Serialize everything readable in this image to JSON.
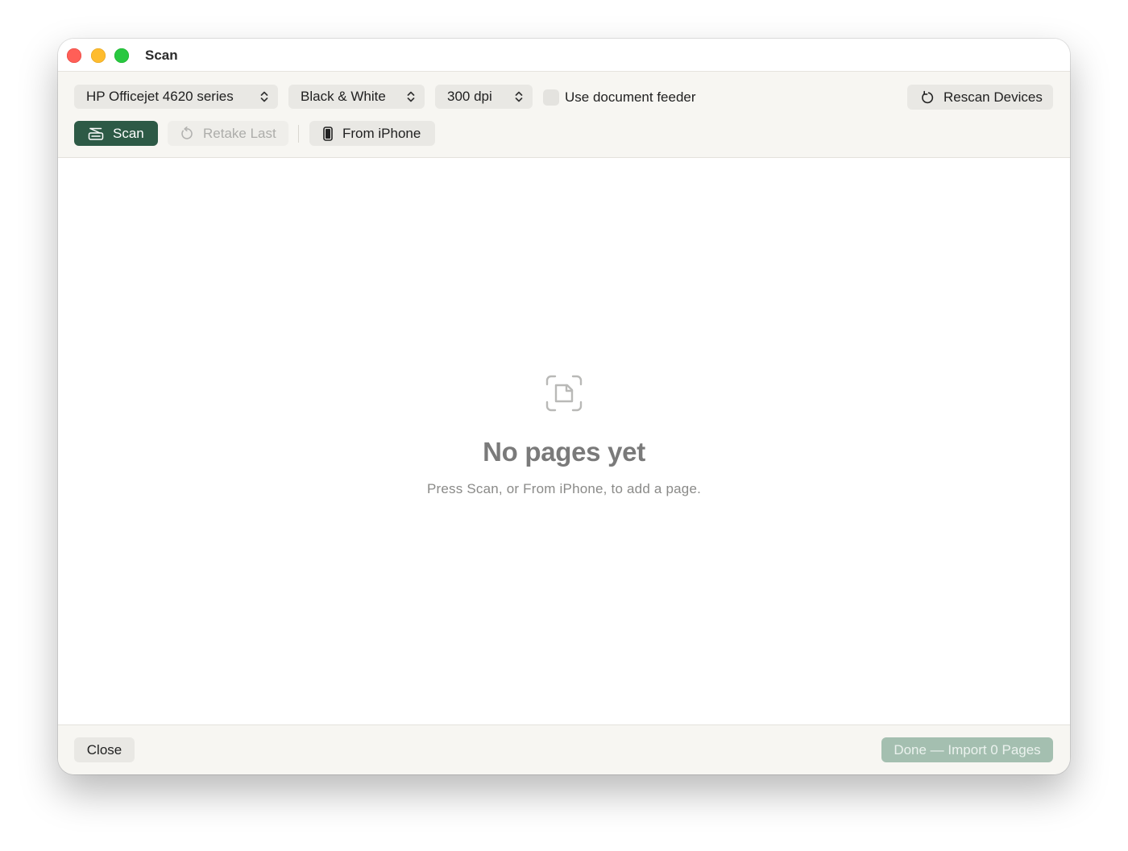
{
  "window": {
    "title": "Scan"
  },
  "toolbar": {
    "scanner_select": {
      "selected": "HP Officejet 4620 series"
    },
    "mode_select": {
      "selected": "Black & White"
    },
    "resolution_select": {
      "selected": "300 dpi"
    },
    "document_feeder": {
      "label": "Use document feeder",
      "checked": false
    },
    "rescan_label": "Rescan Devices",
    "scan_label": "Scan",
    "retake_label": "Retake Last",
    "iphone_label": "From iPhone"
  },
  "empty_state": {
    "title": "No pages yet",
    "subtitle": "Press Scan, or From iPhone, to add a page."
  },
  "footer": {
    "close_label": "Close",
    "done_label": "Done — Import 0 Pages"
  },
  "colors": {
    "accent": "#2d5a46",
    "accent_disabled": "#a4bfb0",
    "toolbar_bg": "#f7f6f2",
    "control_bg": "#e9e8e4"
  },
  "icons": {
    "scan": "scanner-icon",
    "retake": "undo-arrow-icon",
    "iphone": "iphone-icon",
    "rescan": "refresh-icon",
    "empty": "document-scan-icon"
  }
}
